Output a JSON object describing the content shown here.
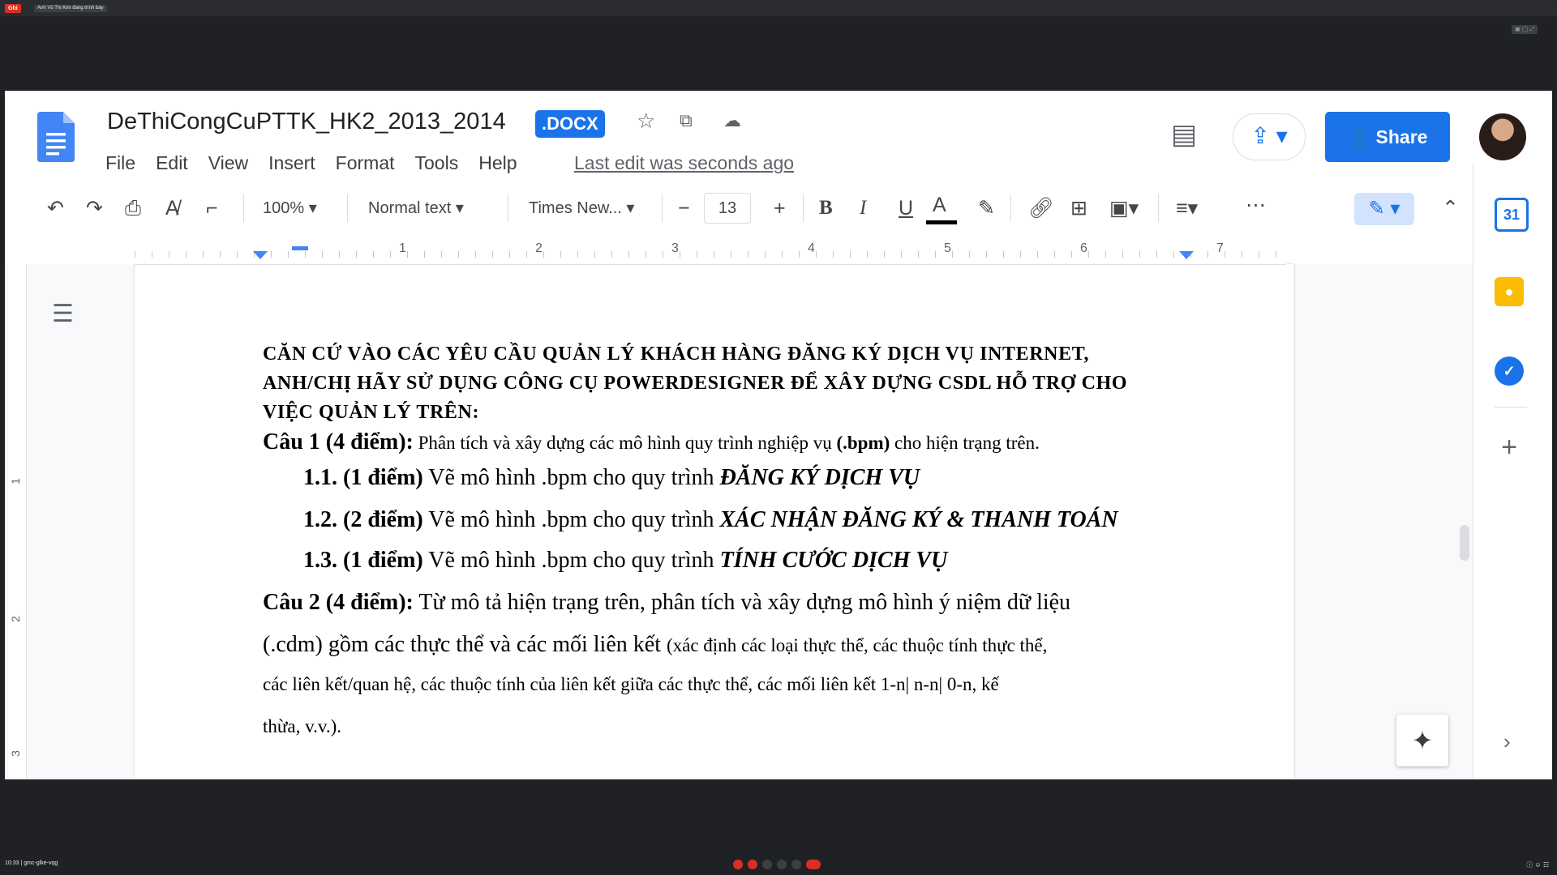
{
  "meet": {
    "recording_label": "Ghi",
    "presenter_label": "Anh Vũ Thị Kim đang trình bày",
    "time_label": "10:33 | gmc-glke-vqg"
  },
  "docs": {
    "title": "DeThiCongCuPTTK_HK2_2013_2014",
    "badge": ".DOCX",
    "menu": [
      "File",
      "Edit",
      "View",
      "Insert",
      "Format",
      "Tools",
      "Help"
    ],
    "last_edit": "Last edit was seconds ago",
    "share_label": "Share",
    "icons": {
      "star": "star-icon",
      "move": "move-to-folder-icon",
      "cloud": "cloud-status-icon",
      "comments": "comments-icon",
      "present": "present-icon"
    }
  },
  "toolbar": {
    "zoom": "100%",
    "style": "Normal text",
    "font": "Times New...",
    "font_size": "13"
  },
  "ruler": {
    "numbers": [
      "1",
      "2",
      "3",
      "4",
      "5",
      "6",
      "7"
    ]
  },
  "left_ruler": {
    "numbers": [
      "1",
      "2",
      "3"
    ]
  },
  "document": {
    "heading_line1": "CĂN CỨ VÀO CÁC YÊU CẦU QUẢN LÝ KHÁCH HÀNG ĐĂNG KÝ DỊCH VỤ INTERNET,",
    "heading_line2": "ANH/CHỊ HÃY SỬ DỤNG CÔNG CỤ POWERDESIGNER ĐỂ XÂY DỰNG CSDL HỖ TRỢ CHO",
    "heading_line3": "VIỆC QUẢN LÝ TRÊN:",
    "q1_label": "Câu 1 (4 điểm):",
    "q1_text_a": " Phân tích và xây dựng các mô hình quy trình nghiệp vụ ",
    "q1_text_b": "(.bpm)",
    "q1_text_c": " cho hiện trạng trên.",
    "q11_label": "1.1. (1 điểm)",
    "q11_text": " Vẽ mô hình .bpm cho quy trình ",
    "q11_em": "ĐĂNG KÝ DỊCH VỤ",
    "q12_label": "1.2. (2 điểm)",
    "q12_text": " Vẽ mô hình .bpm cho quy trình ",
    "q12_em": "XÁC NHẬN ĐĂNG KÝ & THANH TOÁN",
    "q13_label": "1.3. (1 điểm)",
    "q13_text": " Vẽ mô hình .bpm cho quy trình ",
    "q13_em": "TÍNH CƯỚC DỊCH VỤ",
    "q2_label": "Câu 2 (4 điểm):",
    "q2_text": " Từ mô tả hiện trạng trên, phân tích và xây dựng mô hình ý niệm dữ liệu",
    "q2_line2_a": "(.cdm) gồm các thực thể và các mối liên kết ",
    "q2_line2_b": "(xác định các loại thực thể, các thuộc tính thực thể,",
    "q2_line3": "các liên kết/quan hệ, các thuộc tính của liên kết giữa các thực thể, các mối liên kết 1-n| n-n| 0-n, kế",
    "q2_line4": "thừa, v.v.)."
  },
  "side_panel": {
    "calendar_label": "31"
  },
  "colors": {
    "accent": "#1a73e8",
    "meet_bg": "#202124",
    "record_red": "#d93025",
    "keep_yellow": "#fbbc04"
  }
}
